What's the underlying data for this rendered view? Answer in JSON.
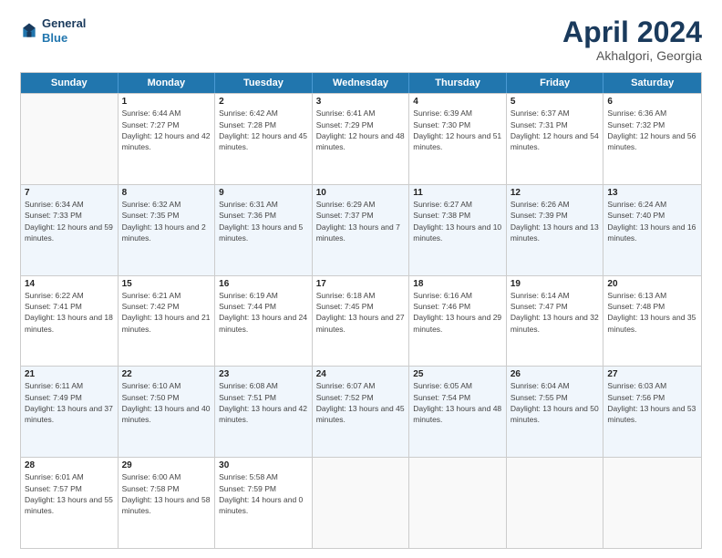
{
  "header": {
    "logo_general": "General",
    "logo_blue": "Blue",
    "title": "April 2024",
    "subtitle": "Akhalgori, Georgia"
  },
  "weekdays": [
    "Sunday",
    "Monday",
    "Tuesday",
    "Wednesday",
    "Thursday",
    "Friday",
    "Saturday"
  ],
  "rows": [
    [
      {
        "day": "",
        "sunrise": "",
        "sunset": "",
        "daylight": "",
        "empty": true
      },
      {
        "day": "1",
        "sunrise": "Sunrise: 6:44 AM",
        "sunset": "Sunset: 7:27 PM",
        "daylight": "Daylight: 12 hours and 42 minutes."
      },
      {
        "day": "2",
        "sunrise": "Sunrise: 6:42 AM",
        "sunset": "Sunset: 7:28 PM",
        "daylight": "Daylight: 12 hours and 45 minutes."
      },
      {
        "day": "3",
        "sunrise": "Sunrise: 6:41 AM",
        "sunset": "Sunset: 7:29 PM",
        "daylight": "Daylight: 12 hours and 48 minutes."
      },
      {
        "day": "4",
        "sunrise": "Sunrise: 6:39 AM",
        "sunset": "Sunset: 7:30 PM",
        "daylight": "Daylight: 12 hours and 51 minutes."
      },
      {
        "day": "5",
        "sunrise": "Sunrise: 6:37 AM",
        "sunset": "Sunset: 7:31 PM",
        "daylight": "Daylight: 12 hours and 54 minutes."
      },
      {
        "day": "6",
        "sunrise": "Sunrise: 6:36 AM",
        "sunset": "Sunset: 7:32 PM",
        "daylight": "Daylight: 12 hours and 56 minutes."
      }
    ],
    [
      {
        "day": "7",
        "sunrise": "Sunrise: 6:34 AM",
        "sunset": "Sunset: 7:33 PM",
        "daylight": "Daylight: 12 hours and 59 minutes."
      },
      {
        "day": "8",
        "sunrise": "Sunrise: 6:32 AM",
        "sunset": "Sunset: 7:35 PM",
        "daylight": "Daylight: 13 hours and 2 minutes."
      },
      {
        "day": "9",
        "sunrise": "Sunrise: 6:31 AM",
        "sunset": "Sunset: 7:36 PM",
        "daylight": "Daylight: 13 hours and 5 minutes."
      },
      {
        "day": "10",
        "sunrise": "Sunrise: 6:29 AM",
        "sunset": "Sunset: 7:37 PM",
        "daylight": "Daylight: 13 hours and 7 minutes."
      },
      {
        "day": "11",
        "sunrise": "Sunrise: 6:27 AM",
        "sunset": "Sunset: 7:38 PM",
        "daylight": "Daylight: 13 hours and 10 minutes."
      },
      {
        "day": "12",
        "sunrise": "Sunrise: 6:26 AM",
        "sunset": "Sunset: 7:39 PM",
        "daylight": "Daylight: 13 hours and 13 minutes."
      },
      {
        "day": "13",
        "sunrise": "Sunrise: 6:24 AM",
        "sunset": "Sunset: 7:40 PM",
        "daylight": "Daylight: 13 hours and 16 minutes."
      }
    ],
    [
      {
        "day": "14",
        "sunrise": "Sunrise: 6:22 AM",
        "sunset": "Sunset: 7:41 PM",
        "daylight": "Daylight: 13 hours and 18 minutes."
      },
      {
        "day": "15",
        "sunrise": "Sunrise: 6:21 AM",
        "sunset": "Sunset: 7:42 PM",
        "daylight": "Daylight: 13 hours and 21 minutes."
      },
      {
        "day": "16",
        "sunrise": "Sunrise: 6:19 AM",
        "sunset": "Sunset: 7:44 PM",
        "daylight": "Daylight: 13 hours and 24 minutes."
      },
      {
        "day": "17",
        "sunrise": "Sunrise: 6:18 AM",
        "sunset": "Sunset: 7:45 PM",
        "daylight": "Daylight: 13 hours and 27 minutes."
      },
      {
        "day": "18",
        "sunrise": "Sunrise: 6:16 AM",
        "sunset": "Sunset: 7:46 PM",
        "daylight": "Daylight: 13 hours and 29 minutes."
      },
      {
        "day": "19",
        "sunrise": "Sunrise: 6:14 AM",
        "sunset": "Sunset: 7:47 PM",
        "daylight": "Daylight: 13 hours and 32 minutes."
      },
      {
        "day": "20",
        "sunrise": "Sunrise: 6:13 AM",
        "sunset": "Sunset: 7:48 PM",
        "daylight": "Daylight: 13 hours and 35 minutes."
      }
    ],
    [
      {
        "day": "21",
        "sunrise": "Sunrise: 6:11 AM",
        "sunset": "Sunset: 7:49 PM",
        "daylight": "Daylight: 13 hours and 37 minutes."
      },
      {
        "day": "22",
        "sunrise": "Sunrise: 6:10 AM",
        "sunset": "Sunset: 7:50 PM",
        "daylight": "Daylight: 13 hours and 40 minutes."
      },
      {
        "day": "23",
        "sunrise": "Sunrise: 6:08 AM",
        "sunset": "Sunset: 7:51 PM",
        "daylight": "Daylight: 13 hours and 42 minutes."
      },
      {
        "day": "24",
        "sunrise": "Sunrise: 6:07 AM",
        "sunset": "Sunset: 7:52 PM",
        "daylight": "Daylight: 13 hours and 45 minutes."
      },
      {
        "day": "25",
        "sunrise": "Sunrise: 6:05 AM",
        "sunset": "Sunset: 7:54 PM",
        "daylight": "Daylight: 13 hours and 48 minutes."
      },
      {
        "day": "26",
        "sunrise": "Sunrise: 6:04 AM",
        "sunset": "Sunset: 7:55 PM",
        "daylight": "Daylight: 13 hours and 50 minutes."
      },
      {
        "day": "27",
        "sunrise": "Sunrise: 6:03 AM",
        "sunset": "Sunset: 7:56 PM",
        "daylight": "Daylight: 13 hours and 53 minutes."
      }
    ],
    [
      {
        "day": "28",
        "sunrise": "Sunrise: 6:01 AM",
        "sunset": "Sunset: 7:57 PM",
        "daylight": "Daylight: 13 hours and 55 minutes."
      },
      {
        "day": "29",
        "sunrise": "Sunrise: 6:00 AM",
        "sunset": "Sunset: 7:58 PM",
        "daylight": "Daylight: 13 hours and 58 minutes."
      },
      {
        "day": "30",
        "sunrise": "Sunrise: 5:58 AM",
        "sunset": "Sunset: 7:59 PM",
        "daylight": "Daylight: 14 hours and 0 minutes."
      },
      {
        "day": "",
        "sunrise": "",
        "sunset": "",
        "daylight": "",
        "empty": true
      },
      {
        "day": "",
        "sunrise": "",
        "sunset": "",
        "daylight": "",
        "empty": true
      },
      {
        "day": "",
        "sunrise": "",
        "sunset": "",
        "daylight": "",
        "empty": true
      },
      {
        "day": "",
        "sunrise": "",
        "sunset": "",
        "daylight": "",
        "empty": true
      }
    ]
  ]
}
